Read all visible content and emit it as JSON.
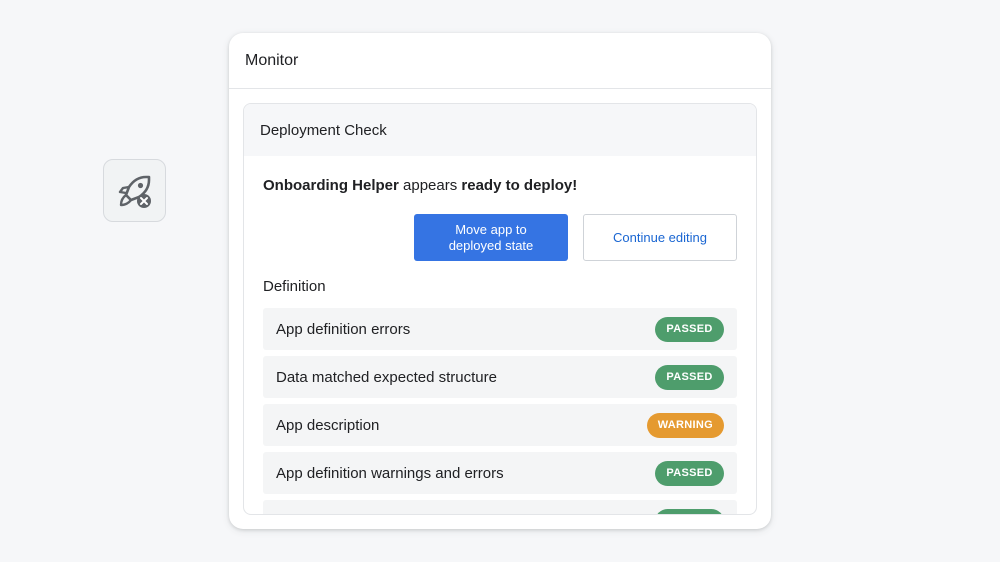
{
  "side_icon": {
    "name": "rocket-error-icon"
  },
  "panel": {
    "title": "Monitor",
    "deployment_check": {
      "title": "Deployment Check",
      "status": {
        "app_name": "Onboarding Helper",
        "middle": " appears ",
        "state": "ready to deploy!"
      },
      "buttons": {
        "primary": "Move app to deployed state",
        "secondary": "Continue editing"
      },
      "definition": {
        "title": "Definition",
        "items": [
          {
            "label": "App definition errors",
            "status": "PASSED",
            "color": "#4e9d6c"
          },
          {
            "label": "Data matched expected structure",
            "status": "PASSED",
            "color": "#4e9d6c"
          },
          {
            "label": "App description",
            "status": "WARNING",
            "color": "#e59a30"
          },
          {
            "label": "App definition warnings and errors",
            "status": "PASSED",
            "color": "#4e9d6c"
          },
          {
            "label": "",
            "status": "",
            "color": "#4e9d6c"
          }
        ]
      }
    }
  },
  "colors": {
    "primary_button": "#3574e3",
    "link_text": "#1a66d2",
    "passed": "#4e9d6c",
    "warning": "#e59a30"
  }
}
